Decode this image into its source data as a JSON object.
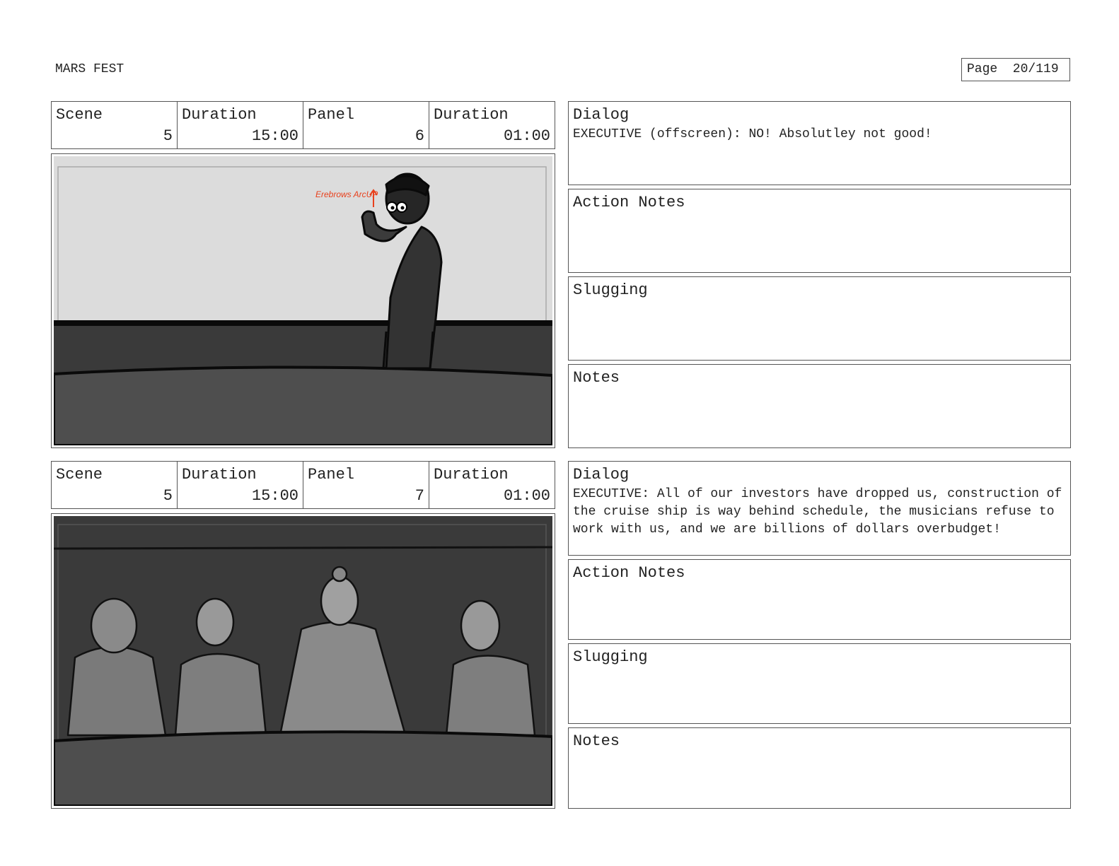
{
  "header": {
    "project_title": "MARS FEST",
    "page_label": "Page  20/119"
  },
  "labels": {
    "scene": "Scene",
    "duration": "Duration",
    "panel": "Panel",
    "dialog": "Dialog",
    "action_notes": "Action Notes",
    "slugging": "Slugging",
    "notes": "Notes"
  },
  "panels": [
    {
      "scene": "5",
      "scene_duration": "15:00",
      "panel": "6",
      "panel_duration": "01:00",
      "dialog": "EXECUTIVE (offscreen): NO! Absolutley not good!",
      "action_notes": "",
      "slugging": "",
      "notes": "",
      "sketch_annotation": "Erebrows ArcUP"
    },
    {
      "scene": "5",
      "scene_duration": "15:00",
      "panel": "7",
      "panel_duration": "01:00",
      "dialog": "EXECUTIVE: All of our investors have dropped us, construction of the cruise ship is way behind schedule, the musicians refuse to work with us, and we are billions of dollars overbudget!",
      "action_notes": "",
      "slugging": "",
      "notes": ""
    }
  ],
  "colors": {
    "annotation_red": "#e8401c",
    "wall_light": "#dcdcdc",
    "wall_dark": "#3a3a3a",
    "table": "#4e4e4e"
  }
}
